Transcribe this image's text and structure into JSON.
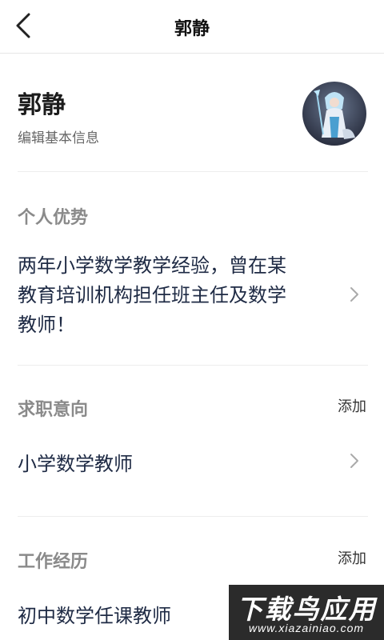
{
  "header": {
    "title": "郭静"
  },
  "profile": {
    "name": "郭静",
    "edit_label": "编辑基本信息"
  },
  "advantage": {
    "title": "个人优势",
    "lines": [
      "两年小学数学教学经验，曾在某",
      "教育培训机构担任班主任及数学",
      "教师！"
    ]
  },
  "intention": {
    "title": "求职意向",
    "add_label": "添加",
    "value": "小学数学教师"
  },
  "experience": {
    "title": "工作经历",
    "add_label": "添加",
    "value": "初中数学任课教师"
  },
  "watermark": {
    "main": "下载鸟应用",
    "sub": "www.xiazainiao.com"
  },
  "colors": {
    "accent_text": "#1e2a44",
    "section_title": "#8a8a8a",
    "divider": "#ededed"
  },
  "icons": [
    "back-arrow-icon",
    "chevron-right-icon",
    "avatar-image"
  ]
}
